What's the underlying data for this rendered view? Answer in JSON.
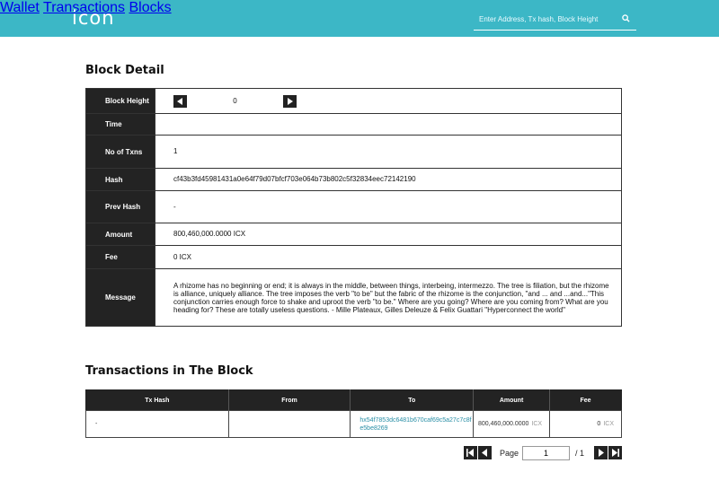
{
  "header": {
    "logo": "icon",
    "nav": [
      {
        "label": "Wallet"
      },
      {
        "label": "Transactions"
      },
      {
        "label": "Blocks"
      }
    ],
    "search_placeholder": "Enter Address, Tx hash, Block Height"
  },
  "block_detail": {
    "title": "Block Detail",
    "rows": {
      "block_height": {
        "label": "Block Height",
        "value": "0"
      },
      "time": {
        "label": "Time",
        "value": ""
      },
      "no_of_txns": {
        "label": "No of Txns",
        "value": "1"
      },
      "hash": {
        "label": "Hash",
        "value": "cf43b3fd45981431a0e64f79d07bfcf703e064b73b802c5f32834eec72142190"
      },
      "prev_hash": {
        "label": "Prev Hash",
        "value": "-"
      },
      "amount": {
        "label": "Amount",
        "value": "800,460,000.0000 ICX"
      },
      "fee": {
        "label": "Fee",
        "value": "0 ICX"
      },
      "message": {
        "label": "Message",
        "value": "A rhizome has no beginning or end; it is always in the middle, between things, interbeing, intermezzo. The tree is filiation, but the rhizome is alliance, uniquely alliance. The tree imposes the verb \"to be\" but the fabric of the rhizome is the conjunction, \"and ... and ...and...\"This conjunction carries enough force to shake and uproot the verb \"to be.\" Where are you going? Where are you coming from? What are you heading for? These are totally useless questions. - Mille Plateaux, Gilles Deleuze & Felix Guattari \"Hyperconnect the world\""
      }
    }
  },
  "transactions": {
    "title": "Transactions in The Block",
    "columns": [
      "Tx Hash",
      "From",
      "To",
      "Amount",
      "Fee"
    ],
    "rows": [
      {
        "tx_hash": "-",
        "from": "",
        "to": "hx54f7853dc6481b670caf69c5a27c7c8fe5be8269",
        "amount": "800,460,000.0000",
        "amount_unit": "ICX",
        "fee": "0",
        "fee_unit": "ICX"
      }
    ]
  },
  "pagination": {
    "label": "Page",
    "current": "1",
    "total": "/ 1"
  },
  "colors": {
    "brand": "#3cb7c6",
    "dark": "#232323",
    "link": "#2a8fa6"
  }
}
